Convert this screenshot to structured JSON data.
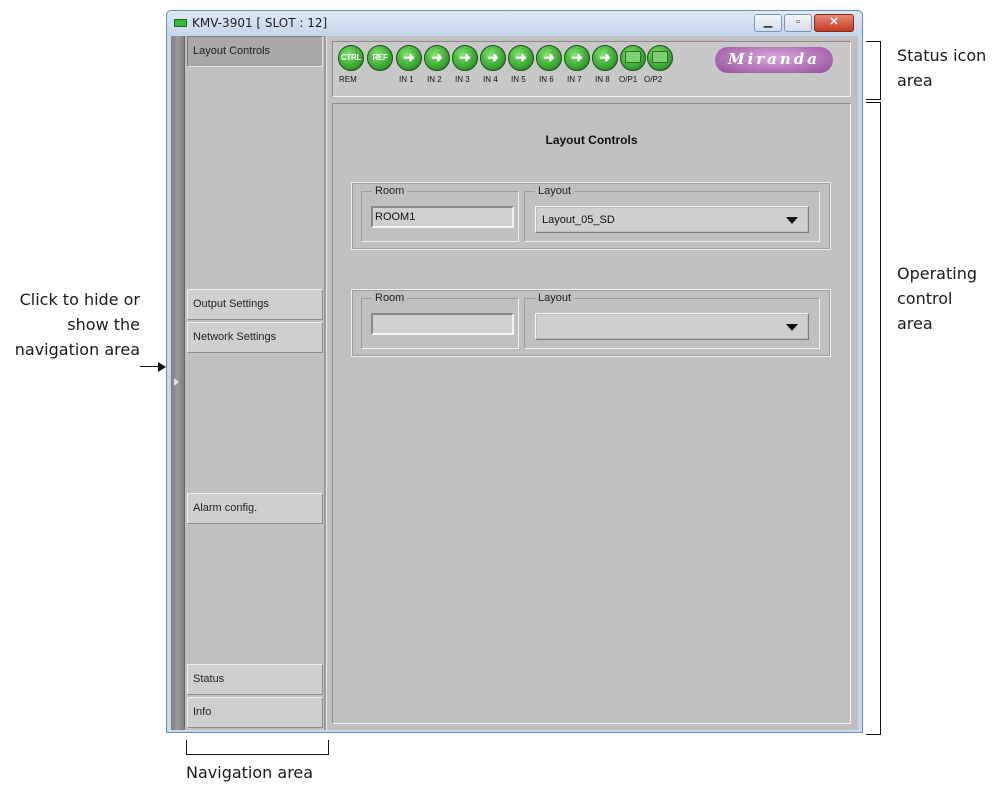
{
  "window": {
    "title": "KMV-3901 [ SLOT : 12]",
    "minimize_icon": "minimize-icon",
    "maximize_icon": "maximize-icon",
    "close_icon": "close-icon"
  },
  "navigation": {
    "items": [
      {
        "label": "Layout Controls",
        "active": true
      },
      {
        "label": "Output Settings",
        "active": false
      },
      {
        "label": "Network Settings",
        "active": false
      },
      {
        "label": "Alarm config.",
        "active": false
      },
      {
        "label": "Status",
        "active": false
      },
      {
        "label": "Info",
        "active": false
      }
    ],
    "toggle_icon": "chevron-right-icon"
  },
  "status_icons": [
    {
      "glyph": "CTRL",
      "label": "REM",
      "color": "#3aa832"
    },
    {
      "glyph": "REF",
      "label": "",
      "color": "#3aa832"
    },
    {
      "glyph": "➜",
      "label": "IN 1",
      "color": "#3aa832"
    },
    {
      "glyph": "➜",
      "label": "IN 2",
      "color": "#3aa832"
    },
    {
      "glyph": "➜",
      "label": "IN 3",
      "color": "#3aa832"
    },
    {
      "glyph": "➜",
      "label": "IN 4",
      "color": "#3aa832"
    },
    {
      "glyph": "➜",
      "label": "IN 5",
      "color": "#3aa832"
    },
    {
      "glyph": "➜",
      "label": "IN 6",
      "color": "#3aa832"
    },
    {
      "glyph": "➜",
      "label": "IN 7",
      "color": "#3aa832"
    },
    {
      "glyph": "➜",
      "label": "IN 8",
      "color": "#3aa832"
    },
    {
      "glyph": "",
      "label": "O/P1",
      "color": "#3aa832"
    },
    {
      "glyph": "",
      "label": "O/P2",
      "color": "#3aa832"
    }
  ],
  "brand": "Miranda",
  "main": {
    "title": "Layout Controls",
    "groups": [
      {
        "room_legend": "Room",
        "room_value": "ROOM1",
        "layout_legend": "Layout",
        "layout_value": "Layout_05_SD"
      },
      {
        "room_legend": "Room",
        "room_value": "",
        "layout_legend": "Layout",
        "layout_value": ""
      }
    ]
  },
  "annotations": {
    "status_area": "Status icon area",
    "operating_area": "Operating control area",
    "toggle": "Click to hide or show the navigation area",
    "navigation_area": "Navigation area"
  }
}
